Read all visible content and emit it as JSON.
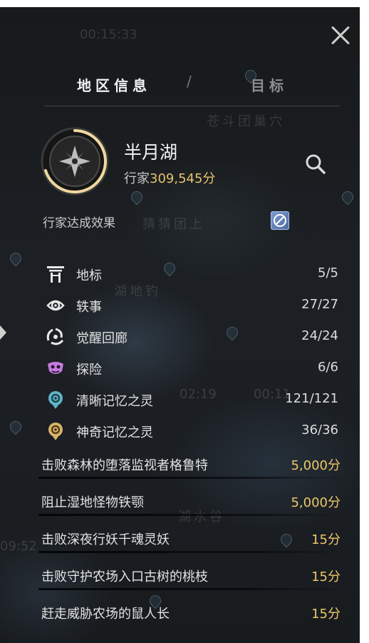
{
  "header": {
    "tabs": [
      {
        "label": "地区信息",
        "active": true
      },
      {
        "label": "目标",
        "active": false
      }
    ],
    "separator": "/",
    "close_icon": "close-icon"
  },
  "region": {
    "name": "半月湖",
    "score_label": "行家",
    "score_value": "309,545分",
    "progress": 0.7,
    "emblem_icon": "compass-star-icon",
    "search_icon": "search-icon"
  },
  "effect": {
    "label": "行家达成效果",
    "icon": "blue-feather-badge-icon"
  },
  "categories": [
    {
      "label": "地标",
      "count": "5/5",
      "icon": "landmark-gate-icon"
    },
    {
      "label": "轶事",
      "count": "27/27",
      "icon": "anecdote-eye-icon"
    },
    {
      "label": "觉醒回廊",
      "count": "24/24",
      "icon": "awakening-swirl-icon"
    },
    {
      "label": "探险",
      "count": "6/6",
      "icon": "adventure-mask-icon"
    },
    {
      "label": "清晰记忆之灵",
      "count": "121/121",
      "icon": "clear-memory-spirit-icon"
    },
    {
      "label": "神奇记忆之灵",
      "count": "36/36",
      "icon": "mystic-memory-spirit-icon"
    }
  ],
  "tasks": [
    {
      "label": "击败森林的堕落监视者格鲁特",
      "points": "5,000分"
    },
    {
      "label": "阻止湿地怪物铁颚",
      "points": "5,000分"
    },
    {
      "label": "击败深夜行妖千魂灵妖",
      "points": "15分"
    },
    {
      "label": "击败守护农场入口古树的桃枝",
      "points": "15分"
    },
    {
      "label": "赶走威胁农场的鼠人长",
      "points": "15分"
    }
  ],
  "background": {
    "map_labels": [
      "苍斗团巢穴",
      "猜猜团上",
      "湖地钓",
      "湖水谷"
    ],
    "timers": [
      "00:15:33",
      "02:19",
      "00:11",
      "09:52"
    ]
  },
  "colors": {
    "gold": "#ecc76a",
    "panel": "#1b1f23",
    "text": "#e2e2e2"
  }
}
